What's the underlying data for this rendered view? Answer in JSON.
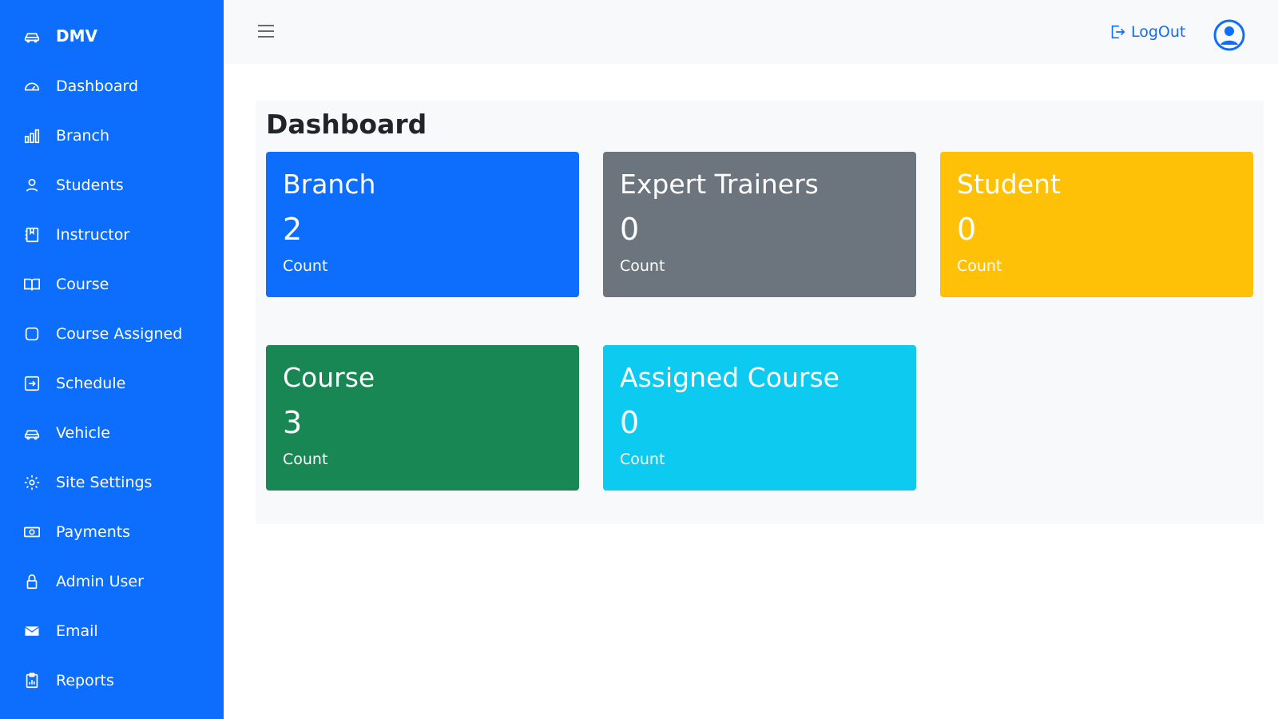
{
  "sidebar": {
    "brand": "DMV",
    "items": [
      {
        "label": "Dashboard"
      },
      {
        "label": "Branch"
      },
      {
        "label": "Students"
      },
      {
        "label": "Instructor"
      },
      {
        "label": "Course"
      },
      {
        "label": "Course Assigned"
      },
      {
        "label": "Schedule"
      },
      {
        "label": "Vehicle"
      },
      {
        "label": "Site Settings"
      },
      {
        "label": "Payments"
      },
      {
        "label": "Admin User"
      },
      {
        "label": "Email"
      },
      {
        "label": "Reports"
      }
    ]
  },
  "topbar": {
    "logout_label": "LogOut"
  },
  "main": {
    "title": "Dashboard",
    "cards": [
      {
        "title": "Branch",
        "value": "2",
        "caption": "Count"
      },
      {
        "title": "Expert Trainers",
        "value": "0",
        "caption": "Count"
      },
      {
        "title": "Student",
        "value": "0",
        "caption": "Count"
      },
      {
        "title": "Course",
        "value": "3",
        "caption": "Count"
      },
      {
        "title": "Assigned Course",
        "value": "0",
        "caption": "Count"
      }
    ]
  },
  "colors": {
    "sidebar": "#0d6efd",
    "primary": "#0d6efd",
    "secondary": "#6c757d",
    "warning": "#ffc107",
    "success": "#198754",
    "info": "#0dcaf0"
  }
}
